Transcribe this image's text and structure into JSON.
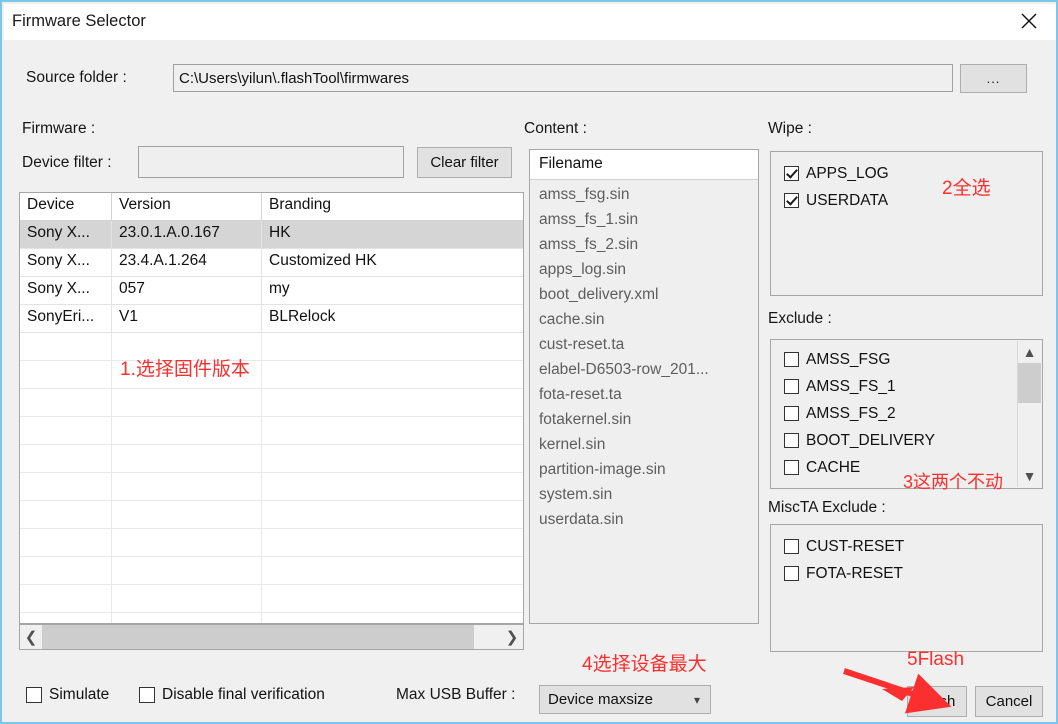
{
  "window": {
    "title": "Firmware Selector",
    "close_icon": "close-icon"
  },
  "source": {
    "label": "Source folder :",
    "value": "C:\\Users\\yilun\\.flashTool\\firmwares",
    "browse_label": "..."
  },
  "firmware": {
    "section_label": "Firmware :",
    "filter_label": "Device filter :",
    "filter_value": "",
    "clear_filter_label": "Clear filter",
    "columns": [
      "Device",
      "Version",
      "Branding"
    ],
    "rows": [
      {
        "device": "Sony X...",
        "version": "23.0.1.A.0.167",
        "branding": "HK",
        "selected": true
      },
      {
        "device": "Sony X...",
        "version": "23.4.A.1.264",
        "branding": "Customized HK",
        "selected": false
      },
      {
        "device": "Sony X...",
        "version": "057",
        "branding": "my",
        "selected": false
      },
      {
        "device": "SonyEri...",
        "version": "V1",
        "branding": "BLRelock",
        "selected": false
      }
    ]
  },
  "content": {
    "section_label": "Content :",
    "column_header": "Filename",
    "items": [
      "amss_fsg.sin",
      "amss_fs_1.sin",
      "amss_fs_2.sin",
      "apps_log.sin",
      "boot_delivery.xml",
      "cache.sin",
      "cust-reset.ta",
      "elabel-D6503-row_201...",
      "fota-reset.ta",
      "fotakernel.sin",
      "kernel.sin",
      "partition-image.sin",
      "system.sin",
      "userdata.sin"
    ]
  },
  "wipe": {
    "section_label": "Wipe :",
    "items": [
      {
        "label": "APPS_LOG",
        "checked": true
      },
      {
        "label": "USERDATA",
        "checked": true
      }
    ]
  },
  "exclude": {
    "section_label": "Exclude :",
    "items": [
      {
        "label": "AMSS_FSG",
        "checked": false
      },
      {
        "label": "AMSS_FS_1",
        "checked": false
      },
      {
        "label": "AMSS_FS_2",
        "checked": false
      },
      {
        "label": "BOOT_DELIVERY",
        "checked": false
      },
      {
        "label": "CACHE",
        "checked": false
      }
    ]
  },
  "miscta_exclude": {
    "section_label": "MiscTA Exclude :",
    "items": [
      {
        "label": "CUST-RESET",
        "checked": false
      },
      {
        "label": "FOTA-RESET",
        "checked": false
      }
    ]
  },
  "bottom": {
    "simulate_label": "Simulate",
    "simulate_checked": false,
    "disable_verification_label": "Disable final verification",
    "disable_verification_checked": false,
    "usb_buffer_label": "Max USB Buffer :",
    "usb_buffer_value": "Device maxsize",
    "flash_label": "Flash",
    "cancel_label": "Cancel"
  },
  "annotations": {
    "color": "#fb2f2f",
    "step1": "1.选择固件版本",
    "step2": "2全选",
    "step3": "3这两个不动",
    "step4": "4选择设备最大",
    "step5": "5Flash"
  }
}
